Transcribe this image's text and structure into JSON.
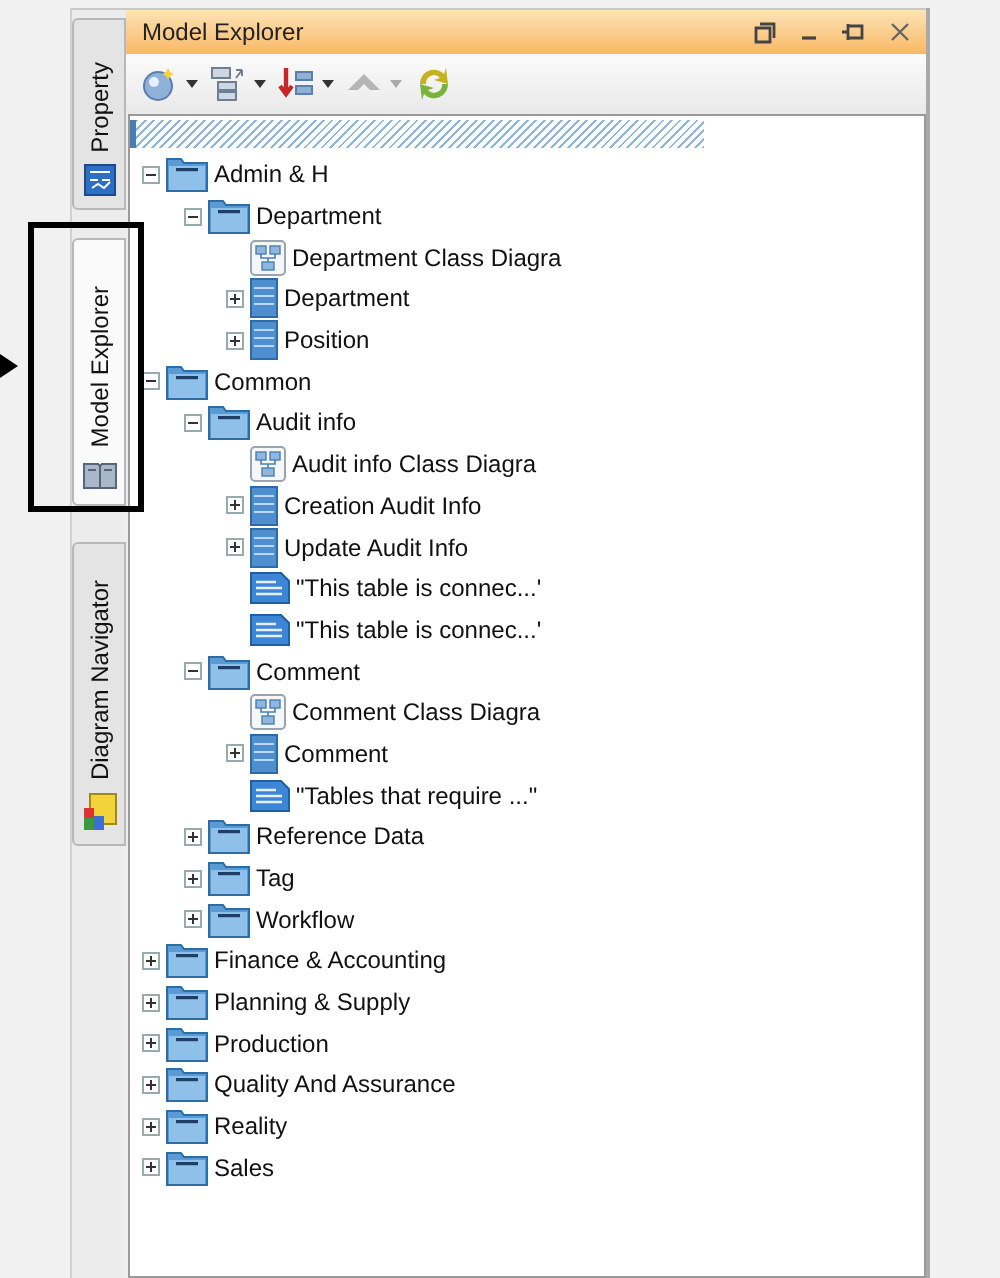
{
  "side_tabs": [
    {
      "label": "Property",
      "kind": "property",
      "selected": false
    },
    {
      "label": "Model Explorer",
      "kind": "explorer",
      "selected": true
    },
    {
      "label": "Diagram Navigator",
      "kind": "navigator",
      "selected": false
    }
  ],
  "panel": {
    "title": "Model Explorer"
  },
  "toolbar": [
    {
      "kind": "new",
      "disabled": false,
      "dropdown": true
    },
    {
      "kind": "structure",
      "disabled": false,
      "dropdown": true
    },
    {
      "kind": "sort",
      "disabled": false,
      "dropdown": true
    },
    {
      "kind": "up",
      "disabled": true,
      "dropdown": true
    },
    {
      "kind": "refresh",
      "disabled": false,
      "dropdown": false
    }
  ],
  "tree": [
    {
      "label": "Admin & H",
      "kind": "package",
      "expanded": true,
      "children": [
        {
          "label": "Department",
          "kind": "package",
          "expanded": true,
          "children": [
            {
              "label": "Department Class Diagra",
              "kind": "diagram"
            },
            {
              "label": "Department",
              "kind": "table",
              "expanded": false
            },
            {
              "label": "Position",
              "kind": "table",
              "expanded": false
            }
          ]
        }
      ]
    },
    {
      "label": "Common",
      "kind": "package",
      "expanded": true,
      "children": [
        {
          "label": "Audit info",
          "kind": "package",
          "expanded": true,
          "children": [
            {
              "label": "Audit info Class Diagra",
              "kind": "diagram"
            },
            {
              "label": "Creation Audit Info",
              "kind": "table",
              "expanded": false
            },
            {
              "label": "Update Audit Info",
              "kind": "table",
              "expanded": false
            },
            {
              "label": "\"This table is connec...'",
              "kind": "note"
            },
            {
              "label": "\"This table is connec...'",
              "kind": "note"
            }
          ]
        },
        {
          "label": "Comment",
          "kind": "package",
          "expanded": true,
          "children": [
            {
              "label": "Comment Class Diagra",
              "kind": "diagram"
            },
            {
              "label": "Comment",
              "kind": "table",
              "expanded": false
            },
            {
              "label": "\"Tables that require ...\"",
              "kind": "note"
            }
          ]
        },
        {
          "label": "Reference Data",
          "kind": "package",
          "expanded": false
        },
        {
          "label": "Tag",
          "kind": "package",
          "expanded": false
        },
        {
          "label": "Workflow",
          "kind": "package",
          "expanded": false
        }
      ]
    },
    {
      "label": "Finance & Accounting",
      "kind": "package",
      "expanded": false
    },
    {
      "label": "Planning & Supply",
      "kind": "package",
      "expanded": false
    },
    {
      "label": "Production",
      "kind": "package",
      "expanded": false
    },
    {
      "label": "Quality And Assurance",
      "kind": "package",
      "expanded": false
    },
    {
      "label": "Reality",
      "kind": "package",
      "expanded": false
    },
    {
      "label": "Sales",
      "kind": "package",
      "expanded": false
    }
  ]
}
